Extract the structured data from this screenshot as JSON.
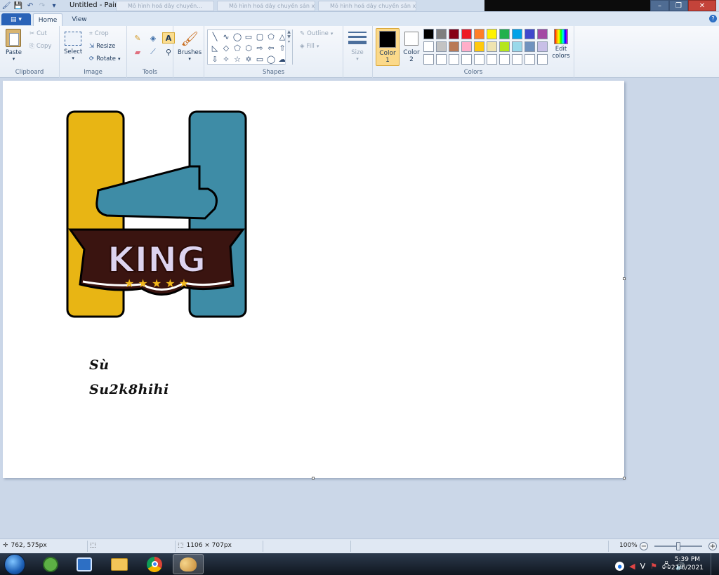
{
  "window": {
    "title": "Untitled - Paint",
    "background_tabs": [
      "Mô hình hoá dây chuyền...",
      "Mô hình hoá dây chuyền sản xuất...",
      "Mô hình hoá dây chuyền sản xuất..."
    ]
  },
  "ribbon": {
    "app_menu_icon": "paint-menu-icon",
    "tabs": [
      "Home",
      "View"
    ],
    "active_tab": "Home",
    "clipboard": {
      "paste": "Paste",
      "cut": "Cut",
      "copy": "Copy",
      "label": "Clipboard"
    },
    "image": {
      "select": "Select",
      "crop": "Crop",
      "resize": "Resize",
      "rotate": "Rotate",
      "label": "Image"
    },
    "tools": {
      "label": "Tools"
    },
    "brushes": {
      "label": "Brushes"
    },
    "shapes": {
      "outline": "Outline",
      "fill": "Fill",
      "label": "Shapes"
    },
    "size": {
      "label": "Size"
    },
    "colors": {
      "color1": "Color 1",
      "color2": "Color 2",
      "edit_colors": "Edit colors",
      "label": "Colors",
      "color1_value": "#000000",
      "color2_value": "#ffffff",
      "palette": [
        "#000000",
        "#7f7f7f",
        "#880015",
        "#ed1c24",
        "#ff7f27",
        "#fff200",
        "#22b14c",
        "#00a2e8",
        "#3f48cc",
        "#a349a4",
        "#ffffff",
        "#c3c3c3",
        "#b97a57",
        "#ffaec9",
        "#ffc90e",
        "#efe4b0",
        "#b5e61d",
        "#99d9ea",
        "#7092be",
        "#c8bfe7",
        "#ffffff",
        "#ffffff",
        "#ffffff",
        "#ffffff",
        "#ffffff",
        "#ffffff",
        "#ffffff",
        "#ffffff",
        "#ffffff",
        "#ffffff"
      ]
    }
  },
  "canvas": {
    "logo_text": "KING",
    "text_line1": "Sù",
    "text_line2": "Su2k8hihi",
    "colors": {
      "left_bar": "#e8b514",
      "right_bar": "#3e8ca6",
      "banner": "#3a1410"
    }
  },
  "status": {
    "cursor_pos": "762, 575px",
    "canvas_size": "1106 × 707px",
    "zoom": "100%"
  },
  "taskbar": {
    "apps": [
      "coccoc-browser",
      "vpn-tool",
      "file-explorer",
      "chrome",
      "paint"
    ],
    "tray_lang": "V",
    "time": "5:39 PM",
    "date": "21/6/2021"
  }
}
